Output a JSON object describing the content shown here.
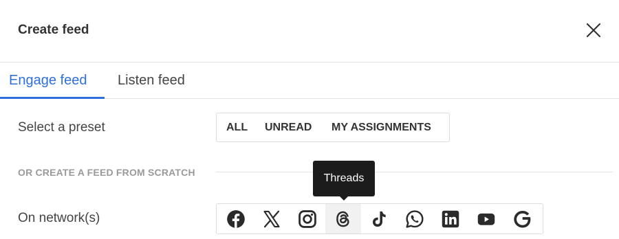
{
  "dialog": {
    "title": "Create feed"
  },
  "tabs": [
    {
      "label": "Engage feed",
      "active": true
    },
    {
      "label": "Listen feed",
      "active": false
    }
  ],
  "preset": {
    "label": "Select a preset",
    "options": [
      "ALL",
      "UNREAD",
      "MY ASSIGNMENTS"
    ]
  },
  "scratch": {
    "label": "OR CREATE A FEED FROM SCRATCH"
  },
  "networks": {
    "label": "On network(s)",
    "items": [
      {
        "name": "facebook",
        "icon": "facebook-icon"
      },
      {
        "name": "x",
        "icon": "x-icon"
      },
      {
        "name": "instagram",
        "icon": "instagram-icon"
      },
      {
        "name": "threads",
        "icon": "threads-icon"
      },
      {
        "name": "tiktok",
        "icon": "tiktok-icon"
      },
      {
        "name": "whatsapp",
        "icon": "whatsapp-icon"
      },
      {
        "name": "linkedin",
        "icon": "linkedin-icon"
      },
      {
        "name": "youtube",
        "icon": "youtube-icon"
      },
      {
        "name": "google",
        "icon": "google-icon"
      }
    ],
    "hovered": "threads"
  },
  "tooltip": {
    "text": "Threads"
  },
  "colors": {
    "accent": "#2f6fdd",
    "icon": "#2b2b2b",
    "tooltip_bg": "#1c1c1c"
  }
}
